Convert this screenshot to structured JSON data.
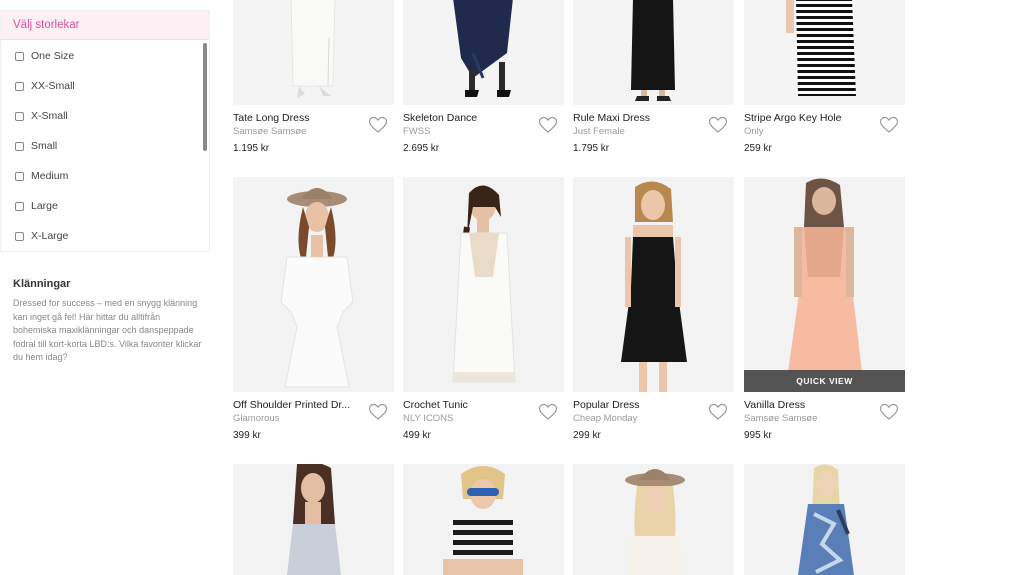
{
  "filter": {
    "title": "Välj storlekar",
    "options": [
      "One Size",
      "XX-Small",
      "X-Small",
      "Small",
      "Medium",
      "Large",
      "X-Large"
    ]
  },
  "category": {
    "title": "Klänningar",
    "description": "Dressed for success – med en snygg klänning kan inget gå fel! Här hittar du alltifrån bohemiska maxiklänningar och danspeppade fodral till kort-korta LBD:s. Vilka favoriter klickar du hem idag?"
  },
  "quick_view_label": "QUICK VIEW",
  "products": [
    {
      "name": "Tate Long Dress",
      "brand": "Samsøe Samsøe",
      "price": "1.195 kr"
    },
    {
      "name": "Skeleton Dance",
      "brand": "FWSS",
      "price": "2.695 kr"
    },
    {
      "name": "Rule Maxi Dress",
      "brand": "Just Female",
      "price": "1.795 kr"
    },
    {
      "name": "Stripe Argo Key Hole",
      "brand": "Only",
      "price": "259 kr"
    },
    {
      "name": "Off Shoulder Printed Dr...",
      "brand": "Glamorous",
      "price": "399 kr"
    },
    {
      "name": "Crochet Tunic",
      "brand": "NLY ICONS",
      "price": "499 kr"
    },
    {
      "name": "Popular Dress",
      "brand": "Cheap Monday",
      "price": "299 kr"
    },
    {
      "name": "Vanilla Dress",
      "brand": "Samsøe Samsøe",
      "price": "995 kr"
    }
  ],
  "colors": {
    "accent_pink": "#e0519a",
    "header_bg": "#fdf0f5",
    "muted_text": "#9a9a9a"
  }
}
